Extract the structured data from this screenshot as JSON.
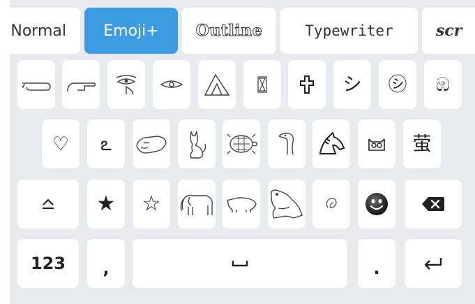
{
  "font_tabs": [
    {
      "label": "Normal",
      "active": false
    },
    {
      "label": "Emoji+",
      "active": true
    },
    {
      "label": "Outline",
      "active": false
    },
    {
      "label": "Typewriter",
      "active": false
    },
    {
      "label": "scr",
      "active": false
    }
  ],
  "row1": [
    "pointing-hand-left",
    "pointing-hand-right",
    "eye-of-horus",
    "eye",
    "tent",
    "hourglass",
    "cross",
    "シ",
    "㋛",
    "ඹ"
  ],
  "row2": [
    "♡",
    "ఽ",
    "hippopotamus",
    "cat",
    "turtle",
    "swan",
    "horse",
    "owl",
    "萤"
  ],
  "row3": {
    "shift": "shift-icon",
    "keys": [
      "★",
      "☆",
      "elephant",
      "pig",
      "frog",
      "ear",
      "smiley"
    ],
    "backspace": "backspace-icon"
  },
  "row4": {
    "numbers_label": "123",
    "comma": ",",
    "space_icon": "space-icon",
    "period": ".",
    "enter_icon": "enter-icon"
  },
  "colors": {
    "accent": "#3d9be2",
    "keyboard_bg": "#e8eaed",
    "key_bg": "#ffffff",
    "text": "#222222"
  }
}
